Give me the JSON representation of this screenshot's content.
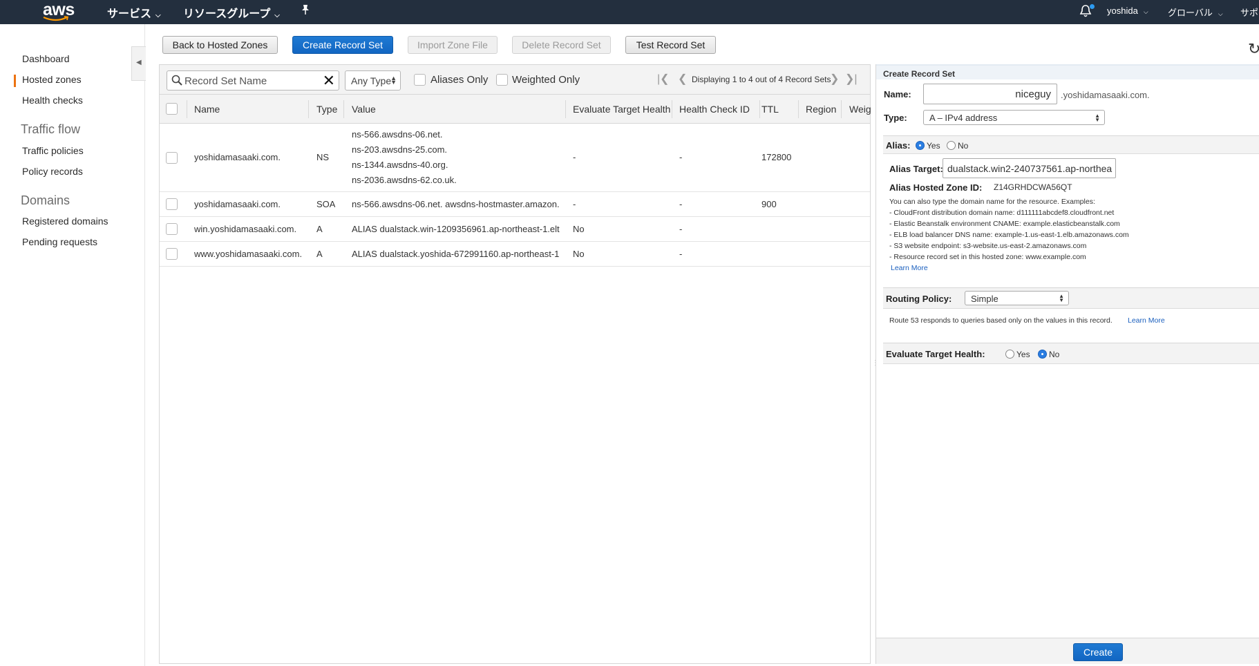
{
  "topbar": {
    "logo": "aws",
    "services": "サービス",
    "resource_groups": "リソースグループ",
    "user": "yoshida",
    "region": "グローバル",
    "support": "サポ",
    "bell_icon": "bell-icon",
    "pin_icon": "pin-icon"
  },
  "sidebar": {
    "dashboard": "Dashboard",
    "hosted_zones": "Hosted zones",
    "health_checks": "Health checks",
    "traffic_flow": "Traffic flow",
    "traffic_policies": "Traffic policies",
    "policy_records": "Policy records",
    "domains": "Domains",
    "registered_domains": "Registered domains",
    "pending_requests": "Pending requests"
  },
  "toolbar": {
    "back": "Back to Hosted Zones",
    "create": "Create Record Set",
    "import": "Import Zone File",
    "delete": "Delete Record Set",
    "test": "Test Record Set"
  },
  "filters": {
    "search_placeholder": "Record Set Name",
    "type": "Any Type",
    "aliases_only": "Aliases Only",
    "weighted_only": "Weighted Only",
    "pager": "Displaying 1 to 4 out of 4 Record Sets"
  },
  "table": {
    "headers": [
      "Name",
      "Type",
      "Value",
      "Evaluate Target Health",
      "Health Check ID",
      "TTL",
      "Region",
      "Weig"
    ],
    "rows": [
      {
        "name": "yoshidamasaaki.com.",
        "type": "NS",
        "values": [
          "ns-566.awsdns-06.net.",
          "ns-203.awsdns-25.com.",
          "ns-1344.awsdns-40.org.",
          "ns-2036.awsdns-62.co.uk."
        ],
        "eth": "-",
        "hc": "-",
        "ttl": "172800"
      },
      {
        "name": "yoshidamasaaki.com.",
        "type": "SOA",
        "value": "ns-566.awsdns-06.net. awsdns-hostmaster.amazon.",
        "eth": "-",
        "hc": "-",
        "ttl": "900"
      },
      {
        "name": "win.yoshidamasaaki.com.",
        "type": "A",
        "value": "ALIAS dualstack.win-1209356961.ap-northeast-1.elt",
        "eth": "No",
        "hc": "-",
        "ttl": ""
      },
      {
        "name": "www.yoshidamasaaki.com.",
        "type": "A",
        "value": "ALIAS dualstack.yoshida-672991160.ap-northeast-1",
        "eth": "No",
        "hc": "-",
        "ttl": ""
      }
    ]
  },
  "panel": {
    "title": "Create Record Set",
    "name_label": "Name:",
    "name_value": "niceguy",
    "name_suffix": ".yoshidamasaaki.com.",
    "type_label": "Type:",
    "type_value": "A – IPv4 address",
    "alias_label": "Alias:",
    "alias_yes": "Yes",
    "alias_no": "No",
    "alias_target_label": "Alias Target:",
    "alias_target_value": "dualstack.win2-240737561.ap-northea",
    "hosted_zone_label": "Alias Hosted Zone ID:",
    "hosted_zone_value": "Z14GRHDCWA56QT",
    "help_intro": "You can also type the domain name for the resource. Examples:",
    "help_items": [
      "-  CloudFront distribution domain name: d111111abcdef8.cloudfront.net",
      "-  Elastic Beanstalk environment CNAME: example.elasticbeanstalk.com",
      "-  ELB load balancer DNS name: example-1.us-east-1.elb.amazonaws.com",
      "-  S3 website endpoint: s3-website.us-east-2.amazonaws.com",
      "-  Resource record set in this hosted zone: www.example.com"
    ],
    "learn_more": "Learn More",
    "routing_label": "Routing Policy:",
    "routing_value": "Simple",
    "routing_desc": "Route 53 responds to queries based only on the values in this record.",
    "eth_label": "Evaluate Target Health:",
    "eth_yes": "Yes",
    "eth_no": "No",
    "create": "Create"
  }
}
